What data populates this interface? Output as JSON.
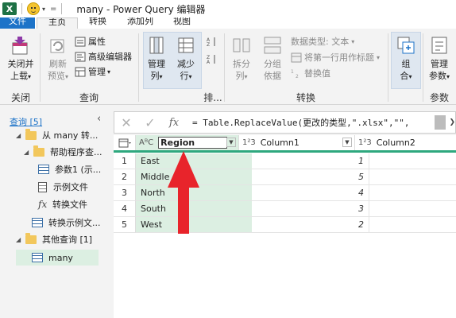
{
  "titlebar": {
    "app_icon": "X",
    "title": "many - Power Query 编辑器"
  },
  "tabs": {
    "file": "文件",
    "home": "主页",
    "transform": "转换",
    "addcol": "添加列",
    "view": "视图"
  },
  "ribbon": {
    "close_load_top": "关闭并",
    "close_load_bottom": "上载",
    "close_group": "关闭",
    "refresh_top": "刷新",
    "refresh_bottom": "预览",
    "properties": "属性",
    "advanced_editor": "高级编辑器",
    "manage": "管理",
    "query_group": "查询",
    "manage_cols_top": "管理",
    "manage_cols_bottom": "列",
    "reduce_rows_top": "减少",
    "reduce_rows_bottom": "行",
    "sort_group": "排...",
    "split_top": "拆分",
    "split_bottom": "列",
    "group_top": "分组",
    "group_bottom": "依据",
    "data_type": "数据类型: 文本",
    "first_row_header": "将第一行用作标题",
    "replace_values": "替换值",
    "transform_group": "转换",
    "combine_top": "组",
    "combine_bottom": "合",
    "params_top": "管理",
    "params_bottom": "参数",
    "params_group": "参数"
  },
  "formula": {
    "cancel": "✕",
    "confirm": "✓",
    "fx": "fx",
    "text": "= Table.ReplaceValue(更改的类型,\".xlsx\",\"\","
  },
  "querypane": {
    "header": "查询 [5]",
    "nodes": [
      {
        "label": "从 many 转..."
      },
      {
        "label": "帮助程序查..."
      },
      {
        "label": "参数1 (示..."
      },
      {
        "label": "示例文件"
      },
      {
        "label": "转换文件"
      },
      {
        "label": "转换示例文..."
      },
      {
        "label": "其他查询 [1]"
      },
      {
        "label": "many"
      }
    ]
  },
  "grid": {
    "columns": [
      {
        "type": "AᴮC",
        "name": "Region"
      },
      {
        "type": "1²3",
        "name": "Column1"
      },
      {
        "type": "1²3",
        "name": "Column2"
      }
    ],
    "rows": [
      {
        "num": "1",
        "region": "East",
        "c1": "1"
      },
      {
        "num": "2",
        "region": "Middle",
        "c1": "5"
      },
      {
        "num": "3",
        "region": "North",
        "c1": "4"
      },
      {
        "num": "4",
        "region": "South",
        "c1": "3"
      },
      {
        "num": "5",
        "region": "West",
        "c1": "2"
      }
    ]
  },
  "colors": {
    "accent_blue": "#1d73c8",
    "grid_green": "#2ea87e",
    "arrow_red": "#e8242b"
  }
}
